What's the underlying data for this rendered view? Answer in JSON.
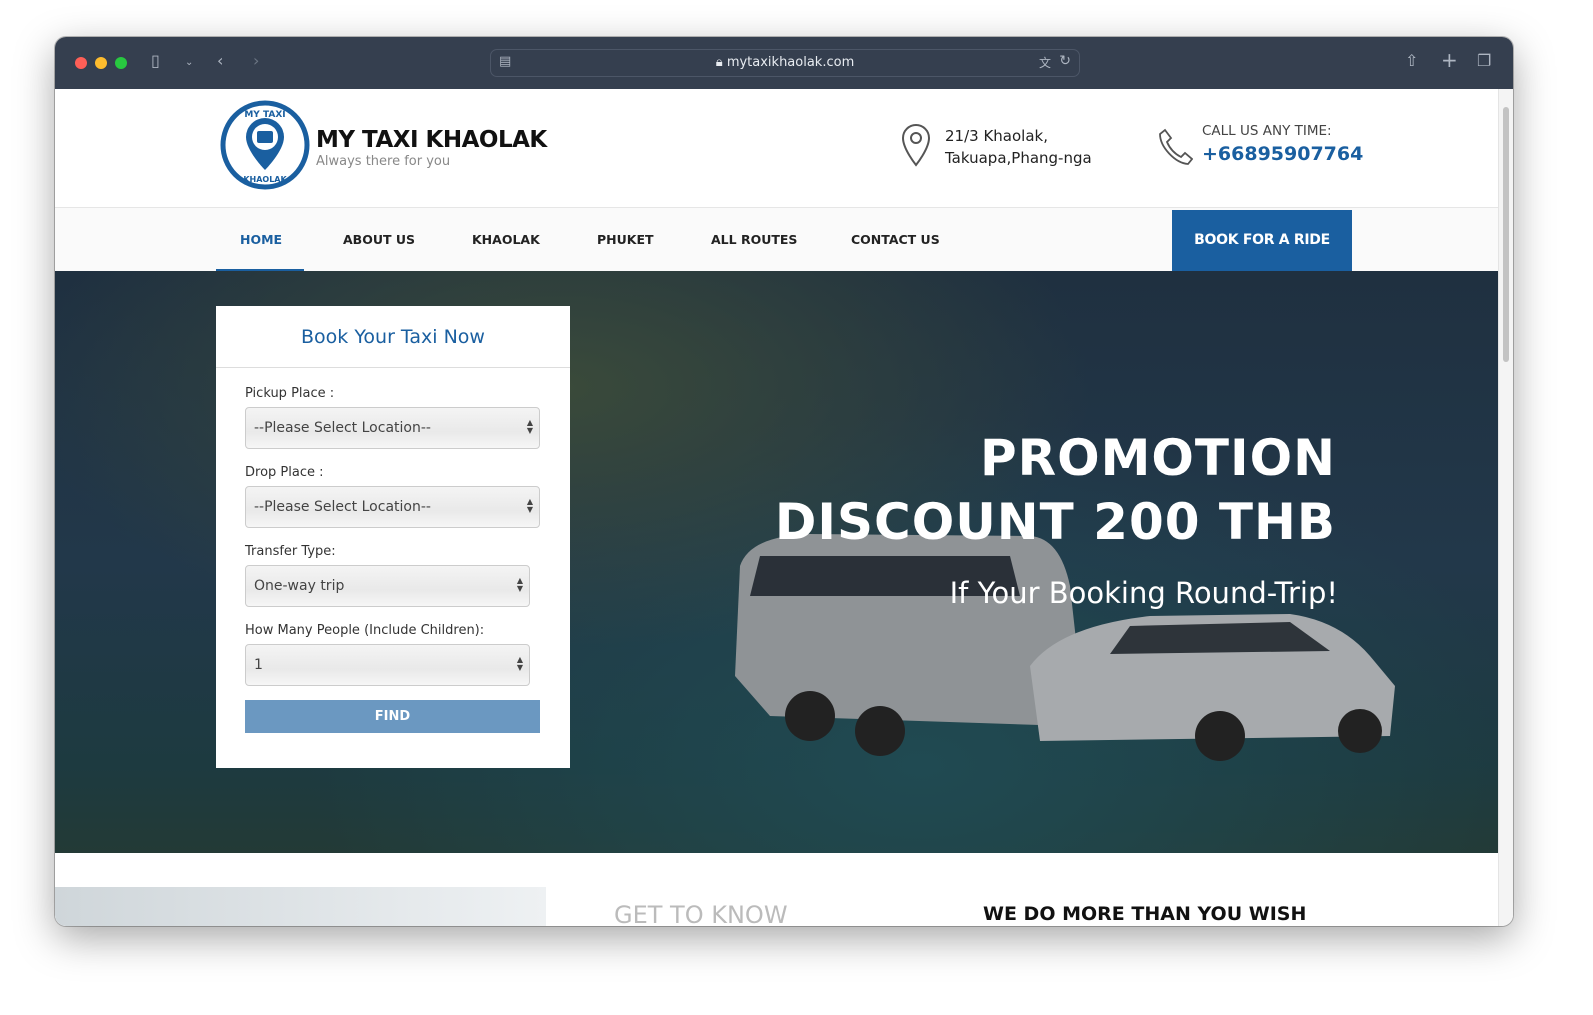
{
  "browser": {
    "url": "mytaxikhaolak.com"
  },
  "header": {
    "brand": "MY TAXI KHAOLAK",
    "tagline": "Always there for you",
    "logo_text_top": "MY TAXI",
    "logo_text_bottom": "KHAOLAK",
    "address_line1": "21/3 Khaolak,",
    "address_line2": "Takuapa,Phang-nga",
    "call_label": "CALL US ANY TIME:",
    "phone": "+66895907764"
  },
  "nav": {
    "items": [
      {
        "label": "HOME",
        "active": true
      },
      {
        "label": "ABOUT US"
      },
      {
        "label": "KHAOLAK"
      },
      {
        "label": "PHUKET"
      },
      {
        "label": "ALL ROUTES"
      },
      {
        "label": "CONTACT US"
      }
    ],
    "book_label": "BOOK FOR A RIDE"
  },
  "booking": {
    "title": "Book Your Taxi Now",
    "pickup_label": "Pickup Place :",
    "pickup_value": "--Please Select Location--",
    "drop_label": "Drop Place :",
    "drop_value": "--Please Select Location--",
    "transfer_label": "Transfer Type:",
    "transfer_value": "One-way trip",
    "people_label": "How Many People (Include Children):",
    "people_value": "1",
    "find_label": "FIND"
  },
  "hero": {
    "line1": "PROMOTION",
    "line2": "DISCOUNT 200 THB",
    "line3": "If Your Booking Round-Trip!"
  },
  "section": {
    "get_to_know": "GET TO KNOW",
    "we_do_more": "WE DO MORE THAN YOU WISH"
  },
  "colors": {
    "brand_blue": "#1a5fa0",
    "toolbar": "#353f4f",
    "find_button": "#6b98c1"
  }
}
